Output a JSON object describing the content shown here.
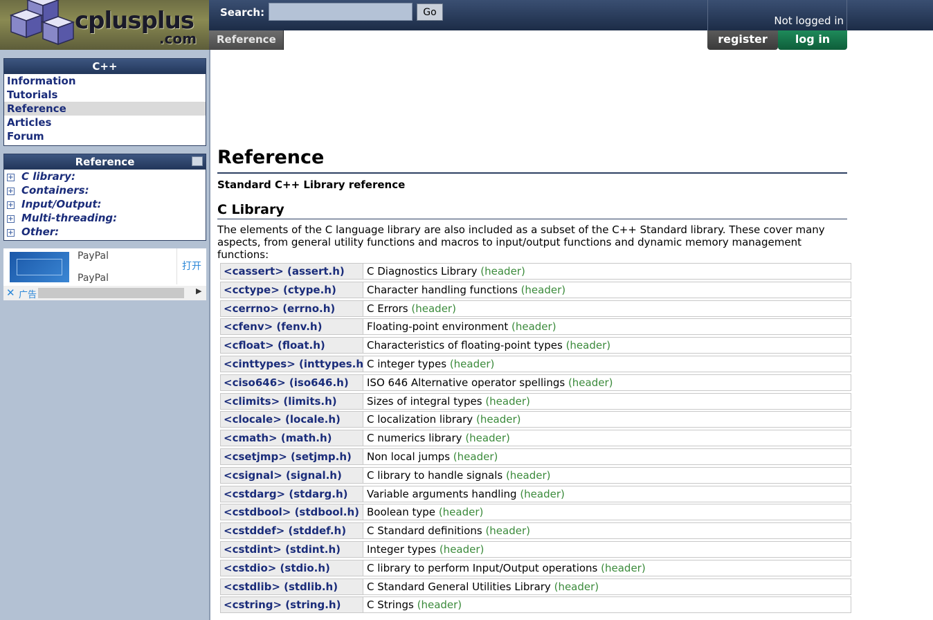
{
  "header": {
    "logo_main": "cplusplus",
    "logo_suffix": ".com",
    "search_label": "Search:",
    "search_value": "",
    "search_button": "Go",
    "login_status": "Not logged in",
    "breadcrumb": "Reference",
    "register_label": "register",
    "login_label": "log in"
  },
  "sidebar": {
    "cpp_title": "C++",
    "nav": [
      "Information",
      "Tutorials",
      "Reference",
      "Articles",
      "Forum"
    ],
    "active_nav": "Reference",
    "ref_title": "Reference",
    "tree": [
      "C library:",
      "Containers:",
      "Input/Output:",
      "Multi-threading:",
      "Other:"
    ],
    "tree_expander": "+"
  },
  "ad": {
    "name1": "PayPal",
    "name2": "PayPal",
    "open": "打开",
    "close": "✕",
    "label": "广告",
    "arrow": "▶"
  },
  "main": {
    "title": "Reference",
    "subtitle": "Standard C++ Library reference",
    "section": "C Library",
    "intro": "The elements of the C language library are also included as a subset of the C++ Standard library. These cover many aspects, from general utility functions and macros to input/output functions and dynamic memory management functions:",
    "kind_label": "(header)",
    "rows": [
      {
        "name": "<cassert> (assert.h)",
        "desc": "C Diagnostics Library"
      },
      {
        "name": "<cctype> (ctype.h)",
        "desc": "Character handling functions"
      },
      {
        "name": "<cerrno> (errno.h)",
        "desc": "C Errors"
      },
      {
        "name": "<cfenv> (fenv.h)",
        "desc": "Floating-point environment"
      },
      {
        "name": "<cfloat> (float.h)",
        "desc": "Characteristics of floating-point types"
      },
      {
        "name": "<cinttypes> (inttypes.h)",
        "desc": "C integer types"
      },
      {
        "name": "<ciso646> (iso646.h)",
        "desc": "ISO 646 Alternative operator spellings"
      },
      {
        "name": "<climits> (limits.h)",
        "desc": "Sizes of integral types"
      },
      {
        "name": "<clocale> (locale.h)",
        "desc": "C localization library"
      },
      {
        "name": "<cmath> (math.h)",
        "desc": "C numerics library"
      },
      {
        "name": "<csetjmp> (setjmp.h)",
        "desc": "Non local jumps"
      },
      {
        "name": "<csignal> (signal.h)",
        "desc": "C library to handle signals"
      },
      {
        "name": "<cstdarg> (stdarg.h)",
        "desc": "Variable arguments handling"
      },
      {
        "name": "<cstdbool> (stdbool.h)",
        "desc": "Boolean type"
      },
      {
        "name": "<cstddef> (stddef.h)",
        "desc": "C Standard definitions"
      },
      {
        "name": "<cstdint> (stdint.h)",
        "desc": "Integer types"
      },
      {
        "name": "<cstdio> (stdio.h)",
        "desc": "C library to perform Input/Output operations"
      },
      {
        "name": "<cstdlib> (stdlib.h)",
        "desc": "C Standard General Utilities Library"
      },
      {
        "name": "<cstring> (string.h)",
        "desc": "C Strings"
      }
    ]
  }
}
